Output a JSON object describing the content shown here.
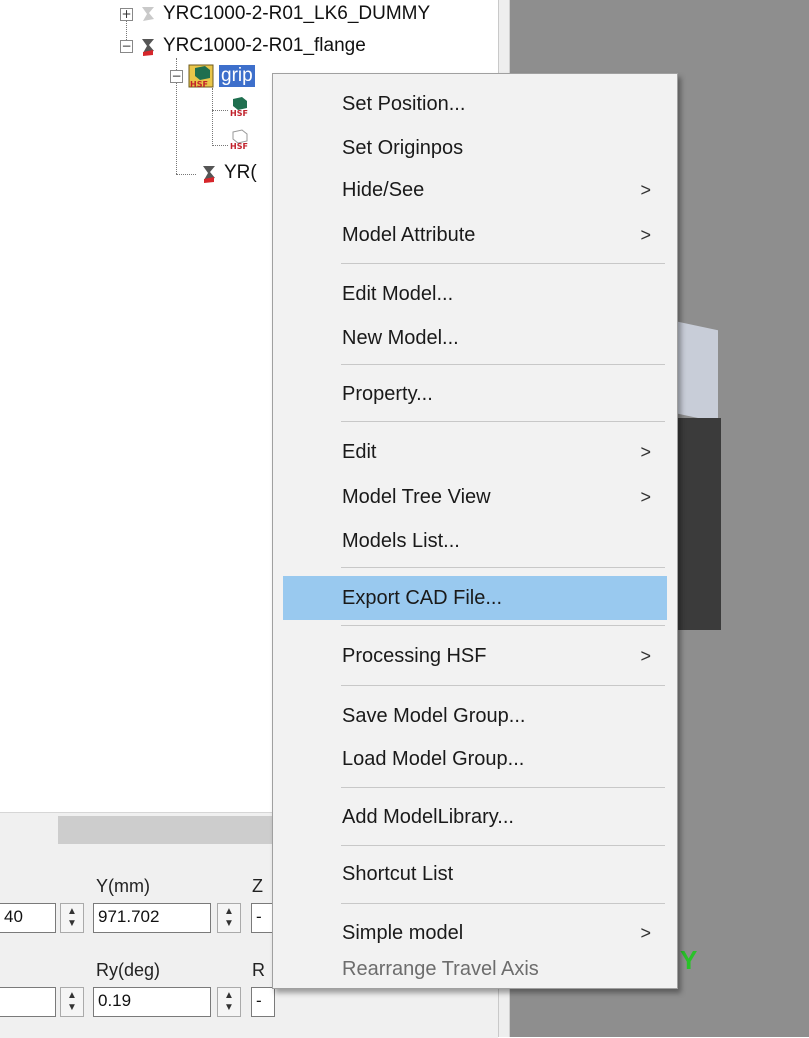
{
  "tree": {
    "rows": [
      {
        "label": "YRC1000-2-R01_LK6_DUMMY"
      },
      {
        "label": "YRC1000-2-R01_flange"
      },
      {
        "label": "grip"
      },
      {
        "label": ""
      },
      {
        "label": ""
      },
      {
        "label": "YR("
      }
    ],
    "icon_text": "HSF"
  },
  "bottom": {
    "y_label": "Y(mm)",
    "z_label": "Z",
    "ry_label": "Ry(deg)",
    "r_label": "R",
    "left_value_1": "40",
    "y_value": "971.702",
    "ry_value": "0.19",
    "z_value": "-",
    "rz_value": "-"
  },
  "viewport": {
    "axis_label": "Y",
    "background": "#8e8e8e"
  },
  "menu": {
    "items": [
      {
        "label": "Set Position...",
        "submenu": false
      },
      {
        "label": "Set Originpos",
        "submenu": false
      },
      {
        "label": "Hide/See",
        "submenu": true
      },
      {
        "label": "Model Attribute",
        "submenu": true
      },
      {
        "label": "Edit Model...",
        "submenu": false
      },
      {
        "label": "New Model...",
        "submenu": false
      },
      {
        "label": "Property...",
        "submenu": false
      },
      {
        "label": "Edit",
        "submenu": true
      },
      {
        "label": "Model Tree View",
        "submenu": true
      },
      {
        "label": "Models List...",
        "submenu": false
      },
      {
        "label": "Export CAD File...",
        "submenu": false,
        "highlighted": true
      },
      {
        "label": "Processing HSF",
        "submenu": true
      },
      {
        "label": "Save Model Group...",
        "submenu": false
      },
      {
        "label": "Load Model Group...",
        "submenu": false
      },
      {
        "label": "Add ModelLibrary...",
        "submenu": false
      },
      {
        "label": "Shortcut List",
        "submenu": false
      },
      {
        "label": "Simple model",
        "submenu": true
      },
      {
        "label": "Rearrange Travel Axis",
        "submenu": false,
        "disabled": true
      }
    ],
    "submenu_arrow": ">",
    "highlight_color": "#99c9ef"
  }
}
